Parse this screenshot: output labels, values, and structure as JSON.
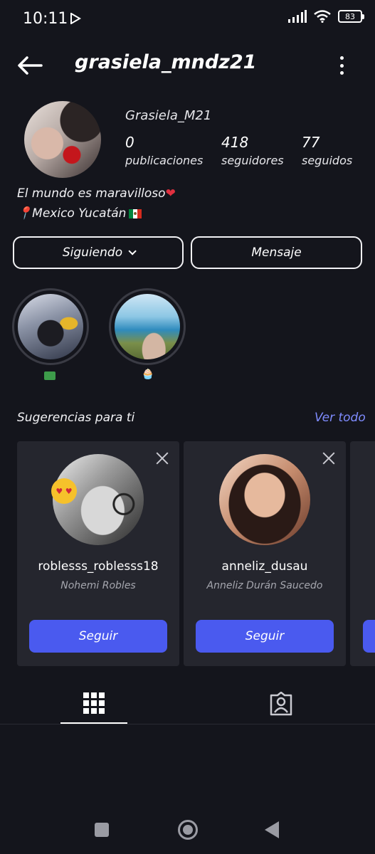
{
  "status_bar": {
    "time": "10:11",
    "battery": "83",
    "icons": [
      "play-store-icon",
      "signal-icon",
      "wifi-icon",
      "battery-icon"
    ]
  },
  "header": {
    "username": "grasiela_mndz21",
    "back_icon": "arrow-left-icon",
    "menu_icon": "more-vertical-icon"
  },
  "profile": {
    "display_name": "Grasiela_M21",
    "stats": [
      {
        "value": "0",
        "label": "publicaciones"
      },
      {
        "value": "418",
        "label": "seguidores"
      },
      {
        "value": "77",
        "label": "seguidos"
      }
    ],
    "bio_line1": "El mundo es maravilloso",
    "bio_line1_emoji": "❤",
    "bio_line2": "Mexico  Yucatán",
    "bio_line2_pin": "📍"
  },
  "actions": {
    "following_label": "Siguiendo",
    "message_label": "Mensaje"
  },
  "highlights": [
    {
      "label": "💵"
    },
    {
      "label": "🧁"
    }
  ],
  "suggestions": {
    "title": "Sugerencias para ti",
    "see_all": "Ver todo",
    "cards": [
      {
        "username": "roblesss_roblesss18",
        "name": "Nohemi Robles",
        "button": "Seguir"
      },
      {
        "username": "anneliz_dusau",
        "name": "Anneliz Durán Saucedo",
        "button": "Seguir"
      }
    ]
  },
  "tabs": [
    {
      "icon": "grid-icon",
      "active": true
    },
    {
      "icon": "tagged-user-icon",
      "active": false
    }
  ],
  "colors": {
    "background": "#14151c",
    "accent": "#4a5aef",
    "link": "#7f8cff",
    "card": "#25262e"
  }
}
